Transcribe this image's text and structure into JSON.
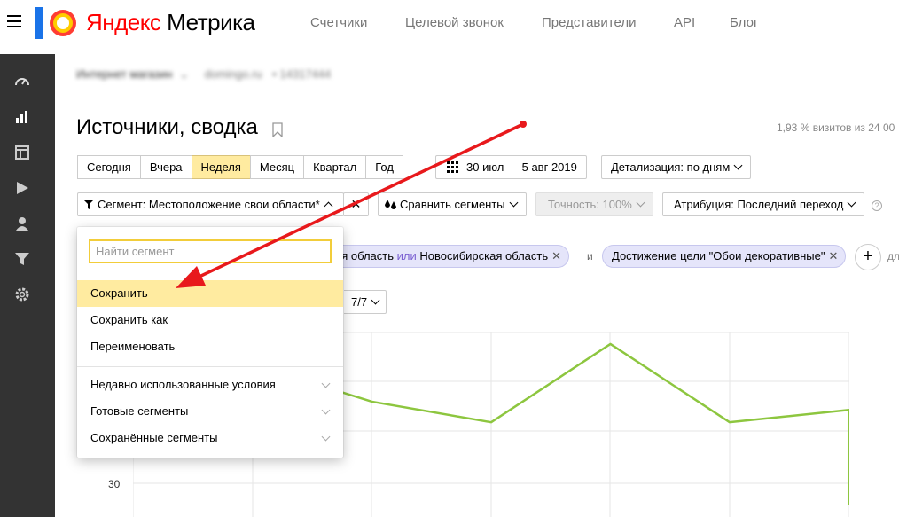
{
  "header": {
    "logo_ya": "Яндекс",
    "logo_rest": " Метрика",
    "nav": [
      "Счетчики",
      "Целевой звонок",
      "Представители",
      "API",
      "Блог"
    ]
  },
  "sidebar": {
    "icons": [
      "dashboard-icon",
      "reports-icon",
      "layout-icon",
      "play-icon",
      "user-icon",
      "filter-icon",
      "gear-icon"
    ]
  },
  "breadcrumb": {
    "site_type": "Интернет магазин",
    "domain": "domingo.ru",
    "counter": "• 14317444"
  },
  "page": {
    "title": "Источники, сводка",
    "visits_note": "1,93 % визитов из 24 00"
  },
  "period_tabs": [
    "Сегодня",
    "Вчера",
    "Неделя",
    "Месяц",
    "Квартал",
    "Год"
  ],
  "period_active": "Неделя",
  "date_range": "30 июл — 5 авг 2019",
  "detail_button": "Детализация: по дням",
  "segment_button": "Сегмент: Местоположение свои области*",
  "compare_button": "Сравнить сегменты",
  "accuracy_button": "Точность: 100%",
  "attribution_button": "Атрибуция: Последний переход",
  "chips": {
    "region_prefix": "кая область ",
    "region_or": "или",
    "region_suffix": " Новосибирская область",
    "and_word": "и",
    "goal": "Достижение цели \"Обои декоративные\"",
    "close_glyph": "✕",
    "cut_label": "дл"
  },
  "series_select": "7/7",
  "chart_data": {
    "type": "line",
    "y_tick_visible": "30",
    "note": "partially obscured line; values approximate",
    "series": [
      {
        "values": [
          62,
          53,
          48,
          67,
          48,
          51,
          28
        ]
      }
    ]
  },
  "segment_menu": {
    "search_placeholder": "Найти сегмент",
    "actions": [
      "Сохранить",
      "Сохранить как",
      "Переименовать"
    ],
    "highlighted": "Сохранить",
    "groups": [
      "Недавно использованные условия",
      "Готовые сегменты",
      "Сохранённые сегменты"
    ]
  },
  "colors": {
    "accent_yellow": "#ffeba0",
    "sidebar_bg": "#333333",
    "chart_line": "#8dc63f",
    "arrow_red": "#e8191c",
    "chip_bg": "#e5e5fa"
  }
}
